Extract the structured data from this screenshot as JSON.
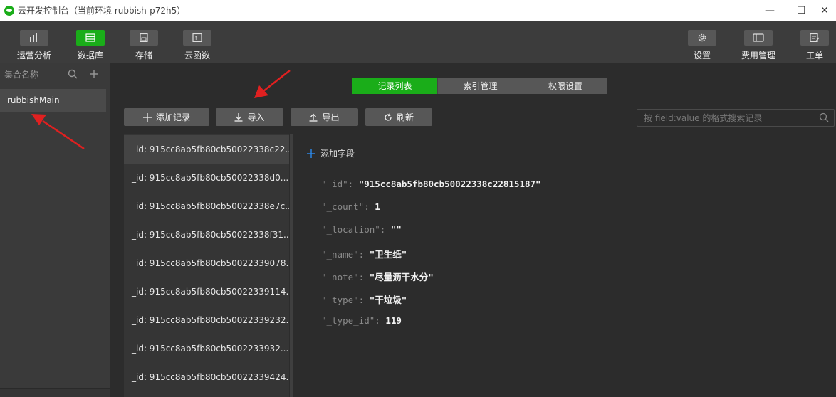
{
  "window": {
    "title": "云开发控制台（当前环境 rubbish-p72h5）",
    "minimize_glyph": "—",
    "maximize_glyph": "☐",
    "close_glyph": "✕"
  },
  "toolbar": {
    "left": [
      {
        "label": "运营分析",
        "icon": "bar-chart-icon",
        "active": false
      },
      {
        "label": "数据库",
        "icon": "database-icon",
        "active": true
      },
      {
        "label": "存储",
        "icon": "storage-icon",
        "active": false
      },
      {
        "label": "云函数",
        "icon": "function-icon",
        "active": false
      }
    ],
    "right": [
      {
        "label": "设置",
        "icon": "gear-icon"
      },
      {
        "label": "费用管理",
        "icon": "billing-icon"
      },
      {
        "label": "工单",
        "icon": "ticket-icon"
      }
    ]
  },
  "sidebar": {
    "header": "集合名称",
    "collections": [
      "rubbishMain"
    ]
  },
  "tabs": [
    "记录列表",
    "索引管理",
    "权限设置"
  ],
  "actions": {
    "add": "添加记录",
    "import": "导入",
    "export": "导出",
    "refresh": "刷新"
  },
  "search": {
    "placeholder": "按 field:value 的格式搜索记录"
  },
  "records": [
    "_id: 915cc8ab5fb80cb50022338c22...",
    "_id: 915cc8ab5fb80cb50022338d0...",
    "_id: 915cc8ab5fb80cb50022338e7c...",
    "_id: 915cc8ab5fb80cb50022338f31...",
    "_id: 915cc8ab5fb80cb50022339078...",
    "_id: 915cc8ab5fb80cb50022339114...",
    "_id: 915cc8ab5fb80cb50022339232...",
    "_id: 915cc8ab5fb80cb5002233932...",
    "_id: 915cc8ab5fb80cb50022339424..."
  ],
  "detail": {
    "add_field": "添加字段",
    "fields": [
      {
        "key": "\"_id\": ",
        "value": "\"915cc8ab5fb80cb50022338c22815187\""
      },
      {
        "key": "\"_count\": ",
        "value": "1"
      },
      {
        "key": "\"_location\": ",
        "value": "\"\""
      },
      {
        "key": "\"_name\": ",
        "value": "\"卫生纸\""
      },
      {
        "key": "\"_note\": ",
        "value": "\"尽量沥干水分\""
      },
      {
        "key": "\"_type\": ",
        "value": "\"干垃圾\""
      },
      {
        "key": "\"_type_id\": ",
        "value": "119"
      }
    ]
  },
  "colors": {
    "accent": "#1aad19",
    "annotation_arrow": "#e02020"
  }
}
